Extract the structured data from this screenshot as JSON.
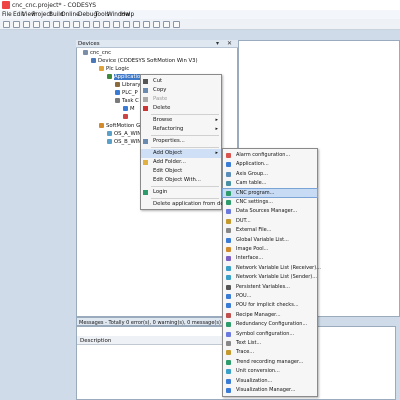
{
  "window": {
    "title": "cnc_cnc.project* - CODESYS"
  },
  "menu": [
    "File",
    "Edit",
    "View",
    "Project",
    "Build",
    "Online",
    "Debug",
    "Tools",
    "Window",
    "Help"
  ],
  "devices": {
    "title": "Devices",
    "controls": [
      "▾",
      "✕"
    ],
    "tree": [
      {
        "label": "cnc_cnc",
        "indent": 0
      },
      {
        "label": "Device (CODESYS SoftMotion Win V3)",
        "indent": 1
      },
      {
        "label": "Plc Logic",
        "indent": 2
      },
      {
        "label": "Application",
        "indent": 3,
        "selected": true
      },
      {
        "label": "Library",
        "indent": 4
      },
      {
        "label": "PLC_P",
        "indent": 4
      },
      {
        "label": "Task C",
        "indent": 4
      },
      {
        "label": "M",
        "indent": 5
      },
      {
        "label": "",
        "indent": 5
      },
      {
        "label": "SoftMotion Ger",
        "indent": 2
      },
      {
        "label": "OS_A_WIN",
        "indent": 3
      },
      {
        "label": "OS_B_WIN",
        "indent": 3
      }
    ]
  },
  "context_menu": [
    {
      "label": "Cut",
      "icon": "scissors-icon"
    },
    {
      "label": "Copy",
      "icon": "copy-icon"
    },
    {
      "label": "Paste",
      "icon": "paste-icon",
      "disabled": true
    },
    {
      "label": "Delete",
      "icon": "delete-icon"
    },
    {
      "sep": true
    },
    {
      "label": "Browse",
      "submenu": true
    },
    {
      "label": "Refactoring",
      "submenu": true
    },
    {
      "sep": true
    },
    {
      "label": "Properties...",
      "icon": "properties-icon"
    },
    {
      "sep": true
    },
    {
      "label": "Add Object",
      "submenu": true,
      "highlighted": true
    },
    {
      "label": "Add Folder...",
      "icon": "folder-icon"
    },
    {
      "label": "Edit Object"
    },
    {
      "label": "Edit Object With..."
    },
    {
      "sep": true
    },
    {
      "label": "Login",
      "icon": "login-icon"
    },
    {
      "sep": true
    },
    {
      "label": "Delete application from device"
    }
  ],
  "add_object_submenu": [
    {
      "label": "Alarm configuration...",
      "color": "#d9534f"
    },
    {
      "label": "Application...",
      "color": "#3a7bd5"
    },
    {
      "label": "Axis Group...",
      "color": "#5b8db8"
    },
    {
      "label": "Cam table...",
      "color": "#4a90a4"
    },
    {
      "label": "CNC program...",
      "color": "#2e9c6a",
      "highlighted": true
    },
    {
      "label": "CNC settings...",
      "color": "#2e9c6a"
    },
    {
      "label": "Data Sources Manager...",
      "color": "#6c7ae0"
    },
    {
      "label": "DUT...",
      "color": "#c49a2c"
    },
    {
      "label": "External File...",
      "color": "#888888"
    },
    {
      "label": "Global Variable List...",
      "color": "#3a7bd5"
    },
    {
      "label": "Image Pool...",
      "color": "#d08a2c"
    },
    {
      "label": "Interface...",
      "color": "#7b5fc4"
    },
    {
      "label": "Network Variable List (Receiver)...",
      "color": "#3aa0c8"
    },
    {
      "label": "Network Variable List (Sender)...",
      "color": "#3aa0c8"
    },
    {
      "label": "Persistent Variables...",
      "color": "#555555"
    },
    {
      "label": "POU...",
      "color": "#3a7bd5"
    },
    {
      "label": "POU for implicit checks...",
      "color": "#3a7bd5"
    },
    {
      "label": "Recipe Manager...",
      "color": "#c0504d"
    },
    {
      "label": "Redundancy Configuration...",
      "color": "#2e9c6a"
    },
    {
      "label": "Symbol configuration...",
      "color": "#6c7ae0"
    },
    {
      "label": "Text List...",
      "color": "#888888"
    },
    {
      "label": "Trace...",
      "color": "#c49a2c"
    },
    {
      "label": "Trend recording manager...",
      "color": "#2e9c6a"
    },
    {
      "label": "Unit conversion...",
      "color": "#3aa0c8"
    },
    {
      "label": "Visualization...",
      "color": "#3a7bd5"
    },
    {
      "label": "Visualization Manager...",
      "color": "#3a7bd5"
    }
  ],
  "messages": {
    "summary": "Messages - Totally 0 error(s), 0 warning(s), 0 message(s)",
    "column_description": "Description"
  }
}
